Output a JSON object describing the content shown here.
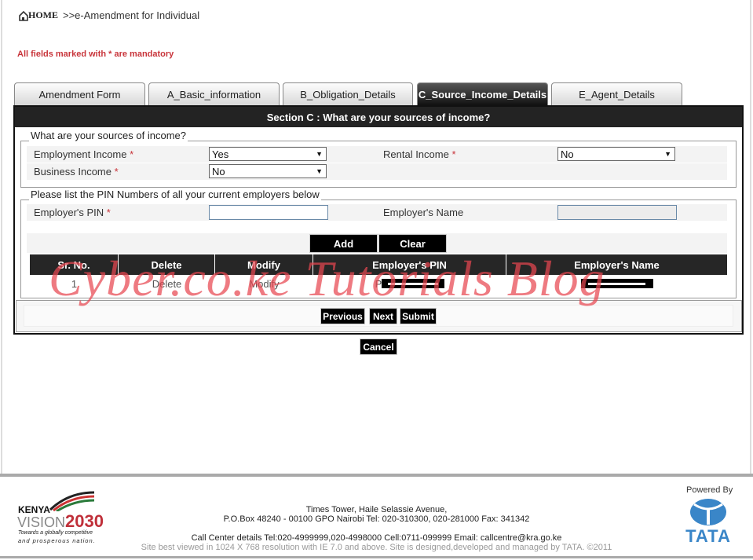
{
  "breadcrumb": {
    "home": "HOME",
    "path": ">>e-Amendment for Individual"
  },
  "mandatory_note": "All fields marked with * are mandatory",
  "tabs": [
    {
      "label": "Amendment Form",
      "active": false
    },
    {
      "label": "A_Basic_information",
      "active": false
    },
    {
      "label": "B_Obligation_Details",
      "active": false
    },
    {
      "label": "C_Source_Income_Details",
      "active": true
    },
    {
      "label": "E_Agent_Details",
      "active": false
    }
  ],
  "section_title": "Section C : What are your sources of income?",
  "income": {
    "legend": "What are your sources of income?",
    "employment_label": "Employment Income",
    "employment_value": "Yes",
    "rental_label": "Rental Income",
    "rental_value": "No",
    "business_label": "Business Income",
    "business_value": "No",
    "required_mark": "*"
  },
  "employers": {
    "legend": "Please list the PIN Numbers of all your current employers below",
    "pin_label": "Employer's PIN",
    "pin_value": "",
    "name_label": "Employer's Name",
    "name_value": "",
    "add": "Add",
    "clear": "Clear",
    "columns": [
      "Sr. No.",
      "Delete",
      "Modify",
      "Employer's PIN",
      "Employer's Name"
    ],
    "rows": [
      {
        "sr": "1",
        "delete": "Delete",
        "modify": "Modify",
        "pin_prefix": "P",
        "pin": "[redacted]",
        "name": "[redacted]"
      }
    ]
  },
  "nav": {
    "previous": "Previous",
    "next": "Next",
    "submit": "Submit",
    "cancel": "Cancel"
  },
  "watermark": "Cyber.co.ke Tutorials Blog",
  "footer": {
    "logo_left": {
      "line1": "KENYA",
      "line2": "VISION",
      "year": "2030",
      "tagline1": "Towards a globally competitive",
      "tagline2": "and prosperous nation."
    },
    "address1": "Times Tower, Haile Selassie Avenue,",
    "address2": "P.O.Box 48240 - 00100 GPO Nairobi Tel: 020-310300, 020-281000 Fax: 341342",
    "callcenter": "Call Center details Tel:020-4999999,020-4998000 Cell:0711-099999 Email: callcentre@kra.go.ke",
    "note": "Site best viewed in 1024 X 768 resolution with IE 7.0 and above. Site is designed,developed and managed by TATA. ©2011",
    "powered_by": "Powered By",
    "tata": "TATA"
  },
  "colors": {
    "accent_red": "#c8343a",
    "header_dark": "#232323",
    "tata_blue": "#3a86c8"
  }
}
